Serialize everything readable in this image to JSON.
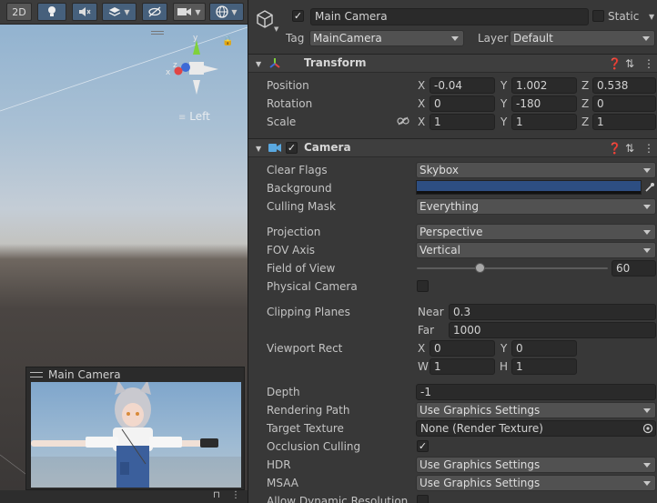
{
  "scene": {
    "toolbar": {
      "btn_2d": "2D",
      "light_icon": "lightbulb-icon",
      "audio_icon": "audio-mute-icon",
      "effects_icon": "layers-icon",
      "hidden_icon": "eye-slash-icon",
      "camera_icon": "video-camera-icon",
      "gizmos_icon": "globe-icon"
    },
    "gizmo": {
      "y_label": "y",
      "x_label": "x",
      "z_label": "z",
      "view_label": "Left"
    },
    "camera_preview": {
      "title": "Main Camera"
    },
    "colors": {
      "sky_top": "#8db0cf",
      "ground": "#4a4542",
      "accent": "#46607c"
    }
  },
  "inspector": {
    "object": {
      "active_checked": true,
      "name": "Main Camera",
      "static_label": "Static",
      "static_checked": false
    },
    "tag": {
      "label": "Tag",
      "value": "MainCamera"
    },
    "layer": {
      "label": "Layer",
      "value": "Default"
    },
    "transform": {
      "title": "Transform",
      "position": {
        "label": "Position",
        "x": "-0.04",
        "y": "1.002",
        "z": "0.538"
      },
      "rotation": {
        "label": "Rotation",
        "x": "0",
        "y": "-180",
        "z": "0"
      },
      "scale": {
        "label": "Scale",
        "x": "1",
        "y": "1",
        "z": "1"
      }
    },
    "camera": {
      "title": "Camera",
      "enabled": true,
      "clear_flags": {
        "label": "Clear Flags",
        "value": "Skybox"
      },
      "background": {
        "label": "Background",
        "color": "#2d4e82"
      },
      "culling_mask": {
        "label": "Culling Mask",
        "value": "Everything"
      },
      "projection": {
        "label": "Projection",
        "value": "Perspective"
      },
      "fov_axis": {
        "label": "FOV Axis",
        "value": "Vertical"
      },
      "field_of_view": {
        "label": "Field of View",
        "value": "60",
        "fraction": 0.33
      },
      "physical_camera": {
        "label": "Physical Camera",
        "checked": false
      },
      "clipping_planes": {
        "label": "Clipping Planes",
        "near_label": "Near",
        "near": "0.3",
        "far_label": "Far",
        "far": "1000"
      },
      "viewport_rect": {
        "label": "Viewport Rect",
        "x_label": "X",
        "x": "0",
        "y_label": "Y",
        "y": "0",
        "w_label": "W",
        "w": "1",
        "h_label": "H",
        "h": "1"
      },
      "depth": {
        "label": "Depth",
        "value": "-1"
      },
      "rendering_path": {
        "label": "Rendering Path",
        "value": "Use Graphics Settings"
      },
      "target_texture": {
        "label": "Target Texture",
        "value": "None (Render Texture)"
      },
      "occlusion_culling": {
        "label": "Occlusion Culling",
        "checked": true
      },
      "hdr": {
        "label": "HDR",
        "value": "Use Graphics Settings"
      },
      "msaa": {
        "label": "MSAA",
        "value": "Use Graphics Settings"
      },
      "allow_dynamic_resolution": {
        "label": "Allow Dynamic Resolution",
        "checked": false
      }
    },
    "axis_labels": {
      "x": "X",
      "y": "Y",
      "z": "Z"
    }
  }
}
